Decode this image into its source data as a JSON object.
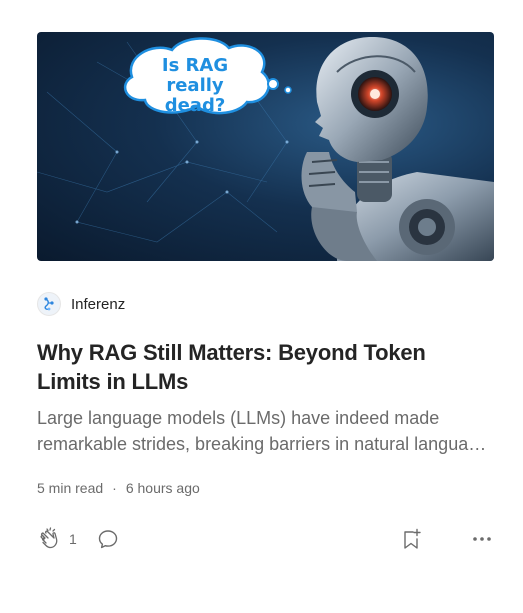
{
  "hero": {
    "bubble_text": "Is RAG\nreally dead?"
  },
  "author": {
    "name": "Inferenz",
    "avatar_icon": "inferenz-logo-icon"
  },
  "article": {
    "title": "Why RAG Still Matters: Beyond Token Limits in LLMs",
    "excerpt": "Large language models (LLMs) have indeed made remarkable strides, breaking barriers in natural language processing",
    "read_time": "5 min read",
    "separator": "·",
    "published": "6 hours ago"
  },
  "actions": {
    "clap_icon": "clap-icon",
    "clap_count": "1",
    "response_icon": "comment-icon",
    "save_icon": "bookmark-add-icon",
    "more_icon": "more-options-icon"
  },
  "colors": {
    "text_primary": "#242424",
    "text_secondary": "#6b6b6b",
    "bubble_text": "#1f8fe0",
    "hero_bg": "#14304f"
  }
}
